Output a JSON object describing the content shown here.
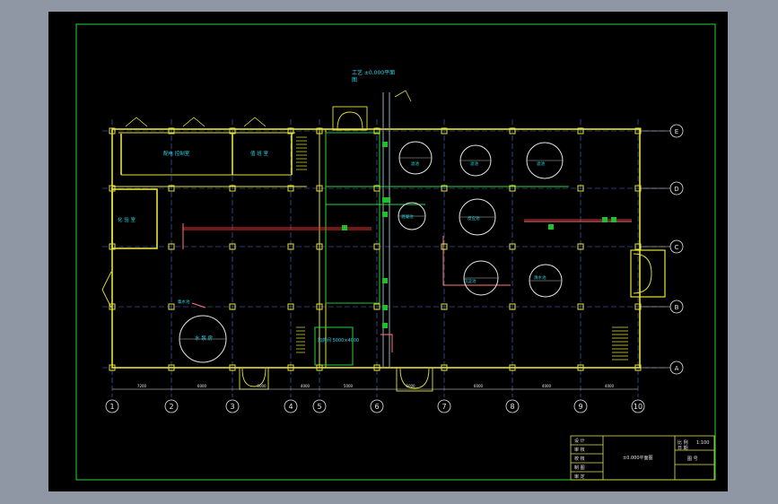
{
  "drawing": {
    "title": "工艺 ±0.000平面",
    "title_sub": "图"
  },
  "grid": {
    "columns": [
      "1",
      "2",
      "3",
      "4",
      "5",
      "6",
      "7",
      "8",
      "9",
      "10"
    ],
    "rows": [
      "E",
      "D",
      "C",
      "B",
      "A"
    ],
    "dims_bottom": [
      "7200",
      "6000",
      "6000",
      "4000",
      "5000",
      "6000",
      "6000",
      "4000",
      "4000"
    ]
  },
  "rooms": [
    {
      "id": "control",
      "label": "配电 控制室"
    },
    {
      "id": "duty",
      "label": "值 班 室"
    },
    {
      "id": "lab",
      "label": "化 验 室"
    },
    {
      "id": "pump",
      "label": "水 泵 房"
    },
    {
      "id": "dosing",
      "label": "加药间 5000×4000"
    }
  ],
  "tank_labels": [
    "滤池",
    "滤池",
    "滤池",
    "混凝池",
    "反应池",
    "沉淀池",
    "清水池",
    "集水池"
  ],
  "title_block": {
    "rows_left": [
      "设 计",
      "审 核",
      "校 核",
      "制 图",
      "审 定"
    ],
    "center": "±0.000平面图",
    "scale_label": "比 例",
    "scale_value": "1:100",
    "date_label": "日 期",
    "sheet_label": "图 号"
  }
}
